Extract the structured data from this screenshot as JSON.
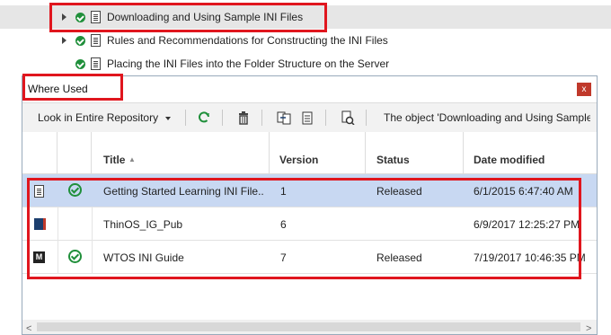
{
  "tree": {
    "items": [
      {
        "label": "Downloading and Using Sample INI Files",
        "icon": "document-icon",
        "status": "approved-check",
        "expander": "expand-arrow"
      },
      {
        "label": "Rules and Recommendations for Constructing the INI Files",
        "icon": "document-icon",
        "status": "approved-check",
        "expander": "expand-arrow"
      },
      {
        "label": "Placing the INI Files into the Folder Structure on the Server",
        "icon": "document-icon",
        "status": "approved-check"
      }
    ]
  },
  "dialog": {
    "title": "Where Used",
    "close_label": "x",
    "toolbar": {
      "scope_dropdown": "Look in Entire Repository",
      "message": "The object 'Downloading and Using Sample I...",
      "icons": [
        "refresh-icon",
        "delete-icon",
        "compare-icon",
        "report-icon",
        "preview-icon"
      ]
    },
    "grid": {
      "columns": {
        "title": "Title",
        "version": "Version",
        "status": "Status",
        "date_modified": "Date modified"
      },
      "sort_indicator": "▲",
      "rows": [
        {
          "type_icon": "document-icon",
          "approved": true,
          "title": "Getting Started Learning INI File...",
          "version": "1",
          "status": "Released",
          "date_modified": "6/1/2015 6:47:40 AM"
        },
        {
          "type_icon": "book-icon",
          "approved": false,
          "title": "ThinOS_IG_Pub",
          "version": "6",
          "status": "",
          "date_modified": "6/9/2017 12:25:27 PM"
        },
        {
          "type_icon": "map-icon",
          "type_letter": "M",
          "approved": true,
          "title": "WTOS INI Guide",
          "version": "7",
          "status": "Released",
          "date_modified": "7/19/2017 10:46:35 PM"
        }
      ]
    },
    "scrollbar": {
      "left": "<",
      "right": ">"
    }
  },
  "colors": {
    "highlight": "#e0161e",
    "selected_row": "#c8d8f2",
    "approved": "#1f8f3a",
    "close_button": "#c0392b"
  }
}
